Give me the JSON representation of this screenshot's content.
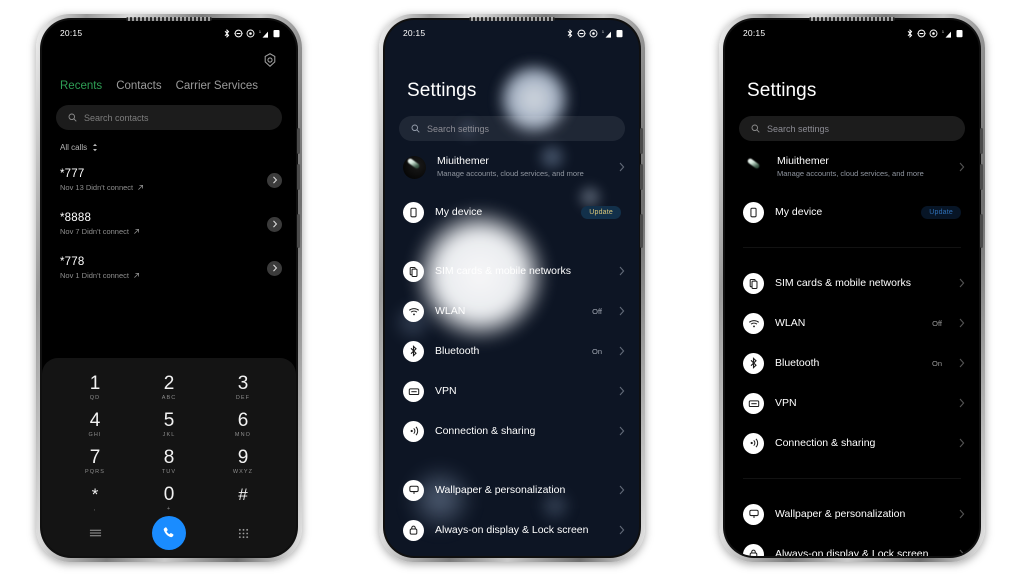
{
  "status_bar": {
    "time": "20:15",
    "icons": [
      "bluetooth-icon",
      "dnd-icon",
      "alarm-icon",
      "signal-icon",
      "battery-icon"
    ]
  },
  "phone1": {
    "app": "Phone",
    "settings_icon": "gear-icon",
    "tabs": [
      {
        "label": "Recents",
        "active": true
      },
      {
        "label": "Contacts",
        "active": false
      },
      {
        "label": "Carrier Services",
        "active": false
      }
    ],
    "search": {
      "placeholder": "Search contacts",
      "icon": "search-icon"
    },
    "filter": {
      "label": "All calls",
      "icon": "sort-icon"
    },
    "calls": [
      {
        "number": "*777",
        "detail": "Nov 13 Didn't connect",
        "direction": "outgoing"
      },
      {
        "number": "*8888",
        "detail": "Nov 7 Didn't connect",
        "direction": "outgoing"
      },
      {
        "number": "*778",
        "detail": "Nov 1 Didn't connect",
        "direction": "outgoing"
      }
    ],
    "dialpad": [
      {
        "digit": "1",
        "letters": "QD"
      },
      {
        "digit": "2",
        "letters": "ABC"
      },
      {
        "digit": "3",
        "letters": "DEF"
      },
      {
        "digit": "4",
        "letters": "GHI"
      },
      {
        "digit": "5",
        "letters": "JKL"
      },
      {
        "digit": "6",
        "letters": "MNO"
      },
      {
        "digit": "7",
        "letters": "PQRS"
      },
      {
        "digit": "8",
        "letters": "TUV"
      },
      {
        "digit": "9",
        "letters": "WXYZ"
      },
      {
        "digit": "*",
        "letters": ","
      },
      {
        "digit": "0",
        "letters": "+"
      },
      {
        "digit": "#",
        "letters": ""
      }
    ],
    "actions": {
      "menu_icon": "menu-icon",
      "call_icon": "call-icon",
      "keypad_icon": "keypad-icon",
      "call_button_color": "#1a8cff"
    }
  },
  "settings": {
    "title": "Settings",
    "search": {
      "placeholder": "Search settings",
      "icon": "search-icon"
    },
    "account": {
      "name": "Miuithemer",
      "subtitle": "Manage accounts, cloud services, and more",
      "avatar": "account-avatar"
    },
    "rows": [
      {
        "label": "My device",
        "icon": "phone-icon",
        "value": "",
        "badge": "Update"
      },
      {
        "label": "SIM cards & mobile networks",
        "icon": "sim-icon",
        "value": "",
        "badge": ""
      },
      {
        "label": "WLAN",
        "icon": "wifi-icon",
        "value": "Off",
        "badge": ""
      },
      {
        "label": "Bluetooth",
        "icon": "bluetooth-icon",
        "value": "On",
        "badge": ""
      },
      {
        "label": "VPN",
        "icon": "vpn-icon",
        "value": "",
        "badge": ""
      },
      {
        "label": "Connection & sharing",
        "icon": "sharing-icon",
        "value": "",
        "badge": ""
      },
      {
        "label": "Wallpaper & personalization",
        "icon": "wallpaper-icon",
        "value": "",
        "badge": ""
      },
      {
        "label": "Always-on display & Lock screen",
        "icon": "lock-icon",
        "value": "",
        "badge": ""
      }
    ]
  },
  "theme": {
    "phone2_background": "#0d1524",
    "phone3_background": "#000000",
    "accent_green": "#2e9e55",
    "badge_gold": "#d9c77a",
    "badge_blue": "#2f6fb5"
  }
}
